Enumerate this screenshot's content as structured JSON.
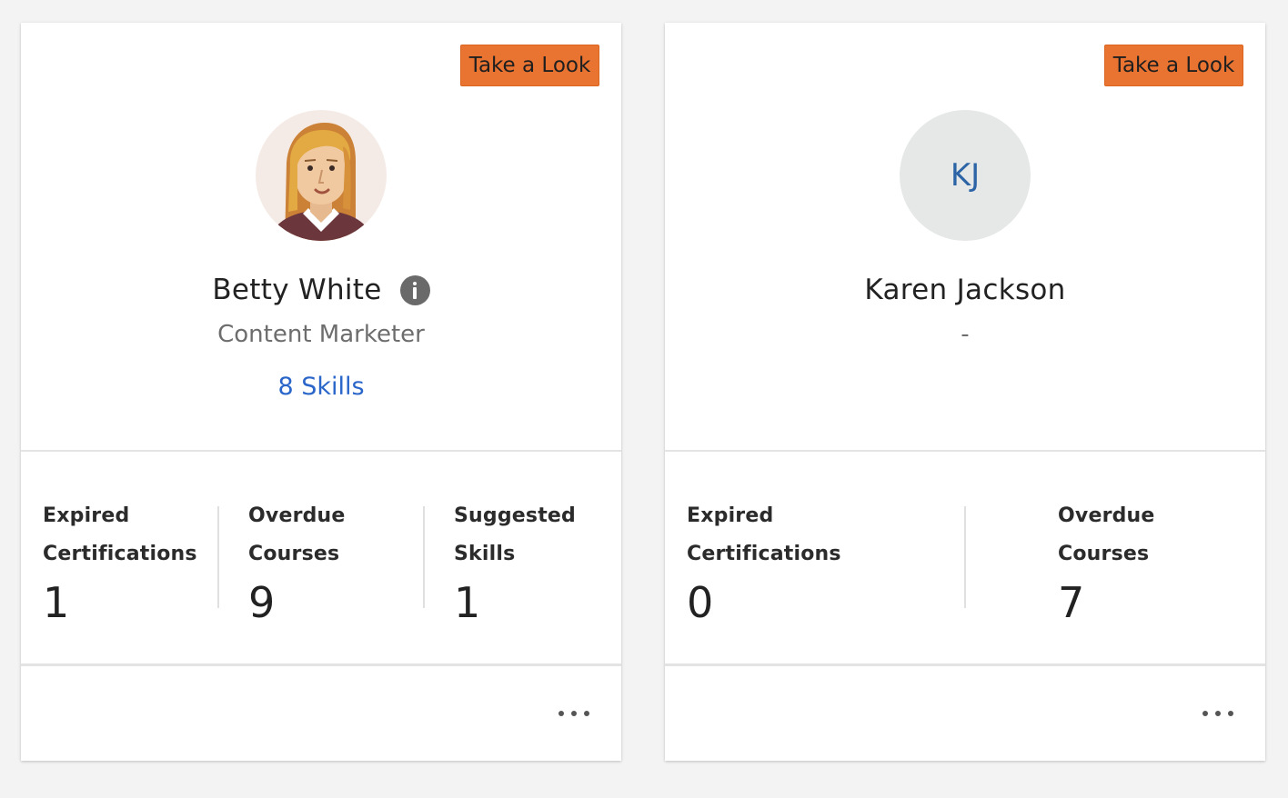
{
  "cards": [
    {
      "button_label": "Take a Look",
      "avatar": "female-avatar-illustration",
      "name": "Betty White",
      "role": "Content Marketer",
      "skills_link": "8 Skills",
      "stats": [
        {
          "label": "Expired\nCertifications",
          "value": "1"
        },
        {
          "label": "Overdue\nCourses",
          "value": "9"
        },
        {
          "label": "Suggested\nSkills",
          "value": "1"
        }
      ]
    },
    {
      "button_label": "Take a Look",
      "initials": "KJ",
      "name": "Karen Jackson",
      "role": "-",
      "stats": [
        {
          "label": "Expired\nCertifications",
          "value": "0"
        },
        {
          "label": "Overdue\nCourses",
          "value": "7"
        }
      ]
    }
  ],
  "colors": {
    "accent_button": "#e97331",
    "link": "#2a66c9",
    "initials": "#2c64a6",
    "page_background": "#f3f3f3"
  }
}
